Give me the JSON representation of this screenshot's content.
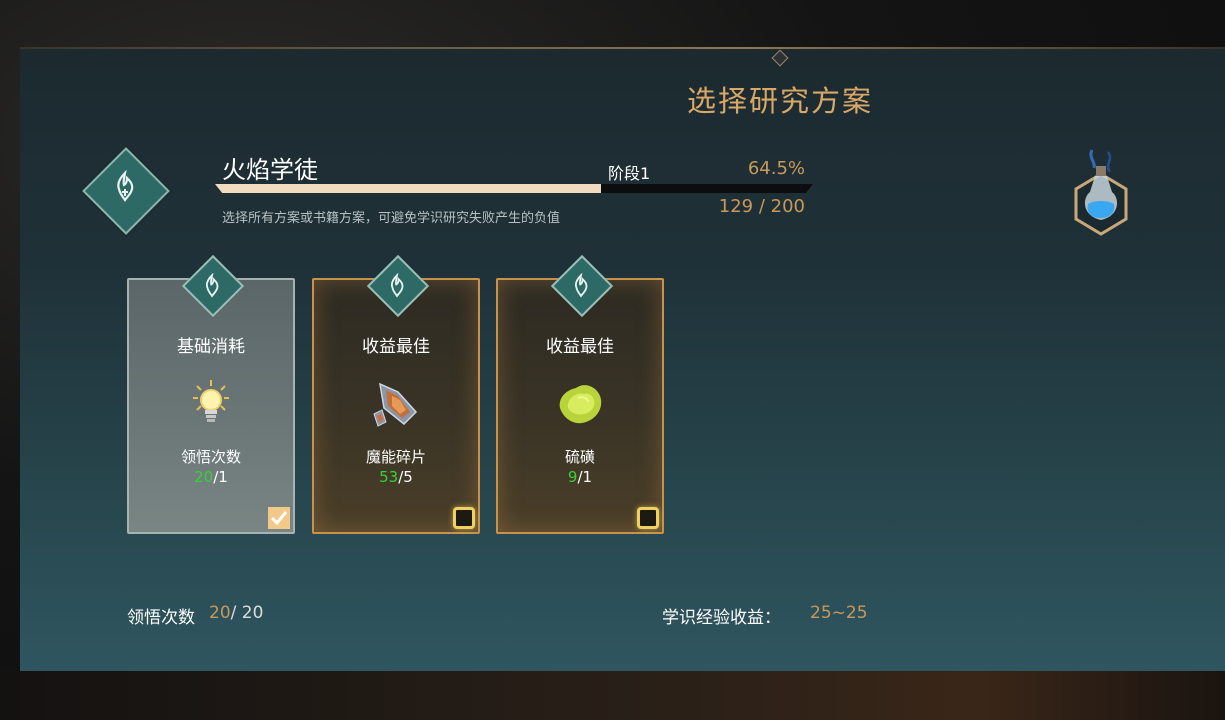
{
  "header": {
    "title": "选择研究方案"
  },
  "research": {
    "name": "火焰学徒",
    "stage": "阶段1",
    "percent_text": "64.5%",
    "progress": 0.645,
    "hint": "选择所有方案或书籍方案，可避免学识研究失败产生的负值",
    "current": "129",
    "total": "200",
    "ratio_text": "129 / 200",
    "icon": "fire-rune-icon"
  },
  "potion": {
    "icon": "blue-potion-icon"
  },
  "cards": [
    {
      "title": "基础消耗",
      "item_name": "领悟次数",
      "item_icon": "lightbulb-icon",
      "have": "20",
      "need": "/1",
      "selected": true,
      "rune_icon": "fire-rune-icon"
    },
    {
      "title": "收益最佳",
      "item_name": "魔能碎片",
      "item_icon": "crystal-shard-icon",
      "have": "53",
      "need": "/5",
      "selected": false,
      "rune_icon": "fire-rune-icon"
    },
    {
      "title": "收益最佳",
      "item_name": "硫磺",
      "item_icon": "sulfur-icon",
      "have": "9",
      "need": "/1",
      "selected": false,
      "rune_icon": "fire-rune-icon"
    }
  ],
  "footer": {
    "insight_label": "领悟次数",
    "insight_current": "20",
    "insight_separator": "/ 20",
    "exp_label": "学识经验收益：",
    "exp_value": "25~25"
  },
  "colors": {
    "accent_gold": "#c8995a",
    "title_gold": "#d9a868",
    "have_green": "#38d238",
    "rune_teal": "#2d6a66"
  }
}
